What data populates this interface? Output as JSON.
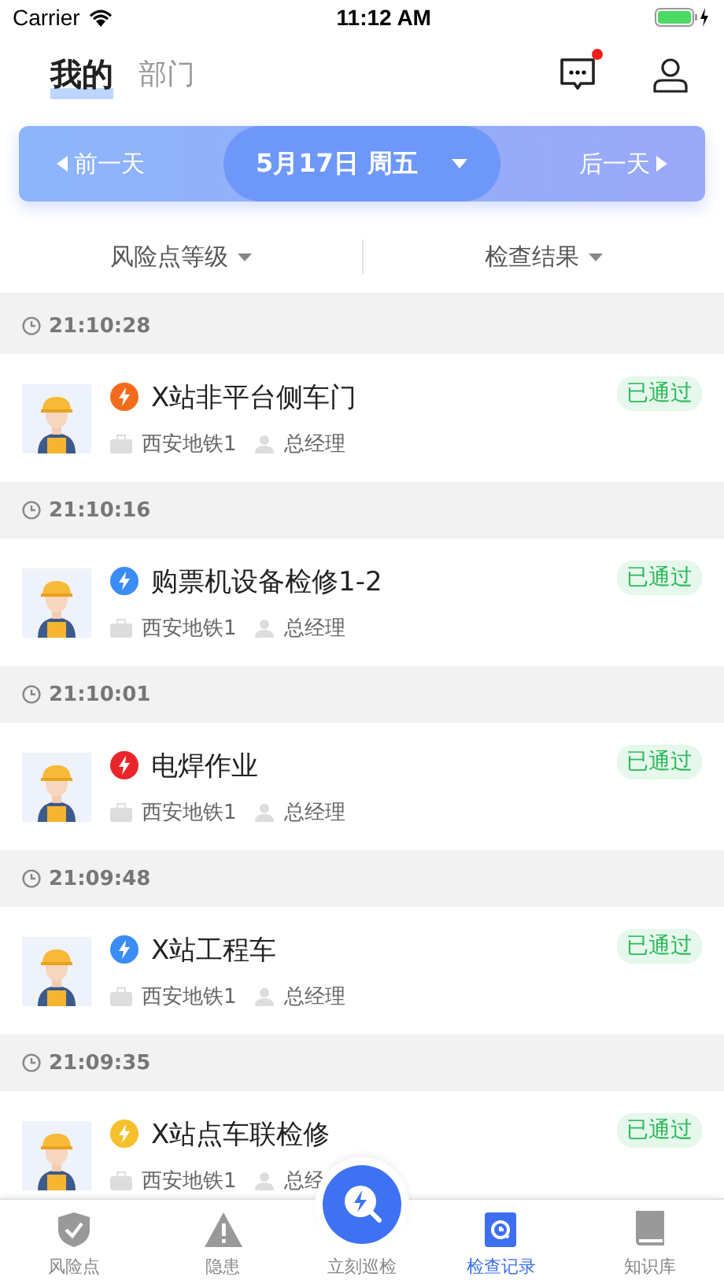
{
  "status_bar": {
    "carrier": "Carrier",
    "time": "11:12 AM"
  },
  "header": {
    "tabs": [
      {
        "label": "我的",
        "selected": true
      },
      {
        "label": "部门",
        "selected": false
      }
    ],
    "messages_unread": true
  },
  "date_bar": {
    "prev": "前一天",
    "date": "5月17日 周五",
    "next": "后一天"
  },
  "filters": [
    "风险点等级",
    "检查结果"
  ],
  "records": [
    {
      "time": "21:10:28",
      "title": "X站非平台侧车门",
      "color": "#f26b1d",
      "company": "西安地铁1",
      "role": "总经理",
      "result": "已通过"
    },
    {
      "time": "21:10:16",
      "title": "购票机设备检修1-2",
      "color": "#3b8cf5",
      "company": "西安地铁1",
      "role": "总经理",
      "result": "已通过"
    },
    {
      "time": "21:10:01",
      "title": "电焊作业",
      "color": "#e8262a",
      "company": "西安地铁1",
      "role": "总经理",
      "result": "已通过"
    },
    {
      "time": "21:09:48",
      "title": "X站工程车",
      "color": "#3b8cf5",
      "company": "西安地铁1",
      "role": "总经理",
      "result": "已通过"
    },
    {
      "time": "21:09:35",
      "title": "X站点车联检修",
      "color": "#f5c02a",
      "company": "西安地铁1",
      "role": "总经",
      "result": "已通过"
    }
  ],
  "tab_bar": [
    {
      "label": "风险点",
      "kind": "shield",
      "selected": false
    },
    {
      "label": "隐患",
      "kind": "warning",
      "selected": false
    },
    {
      "label": "立刻巡检",
      "kind": "center",
      "selected": false
    },
    {
      "label": "检查记录",
      "kind": "record",
      "selected": true
    },
    {
      "label": "知识库",
      "kind": "book",
      "selected": false
    }
  ]
}
